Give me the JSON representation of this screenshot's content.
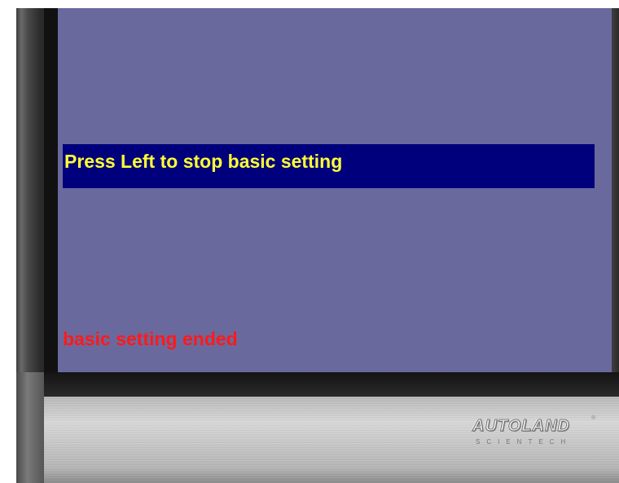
{
  "screen": {
    "highlight_message": "Press Left to stop basic setting",
    "status_message": "basic setting ended"
  },
  "branding": {
    "logo_text": "AUTOLAND",
    "logo_subtext": "SCIENTECH",
    "registered_mark": "®"
  },
  "colors": {
    "screen_background": "#6a699e",
    "highlight_bar": "#00007c",
    "highlight_text": "#ffff33",
    "status_text": "#ff1a1a"
  }
}
